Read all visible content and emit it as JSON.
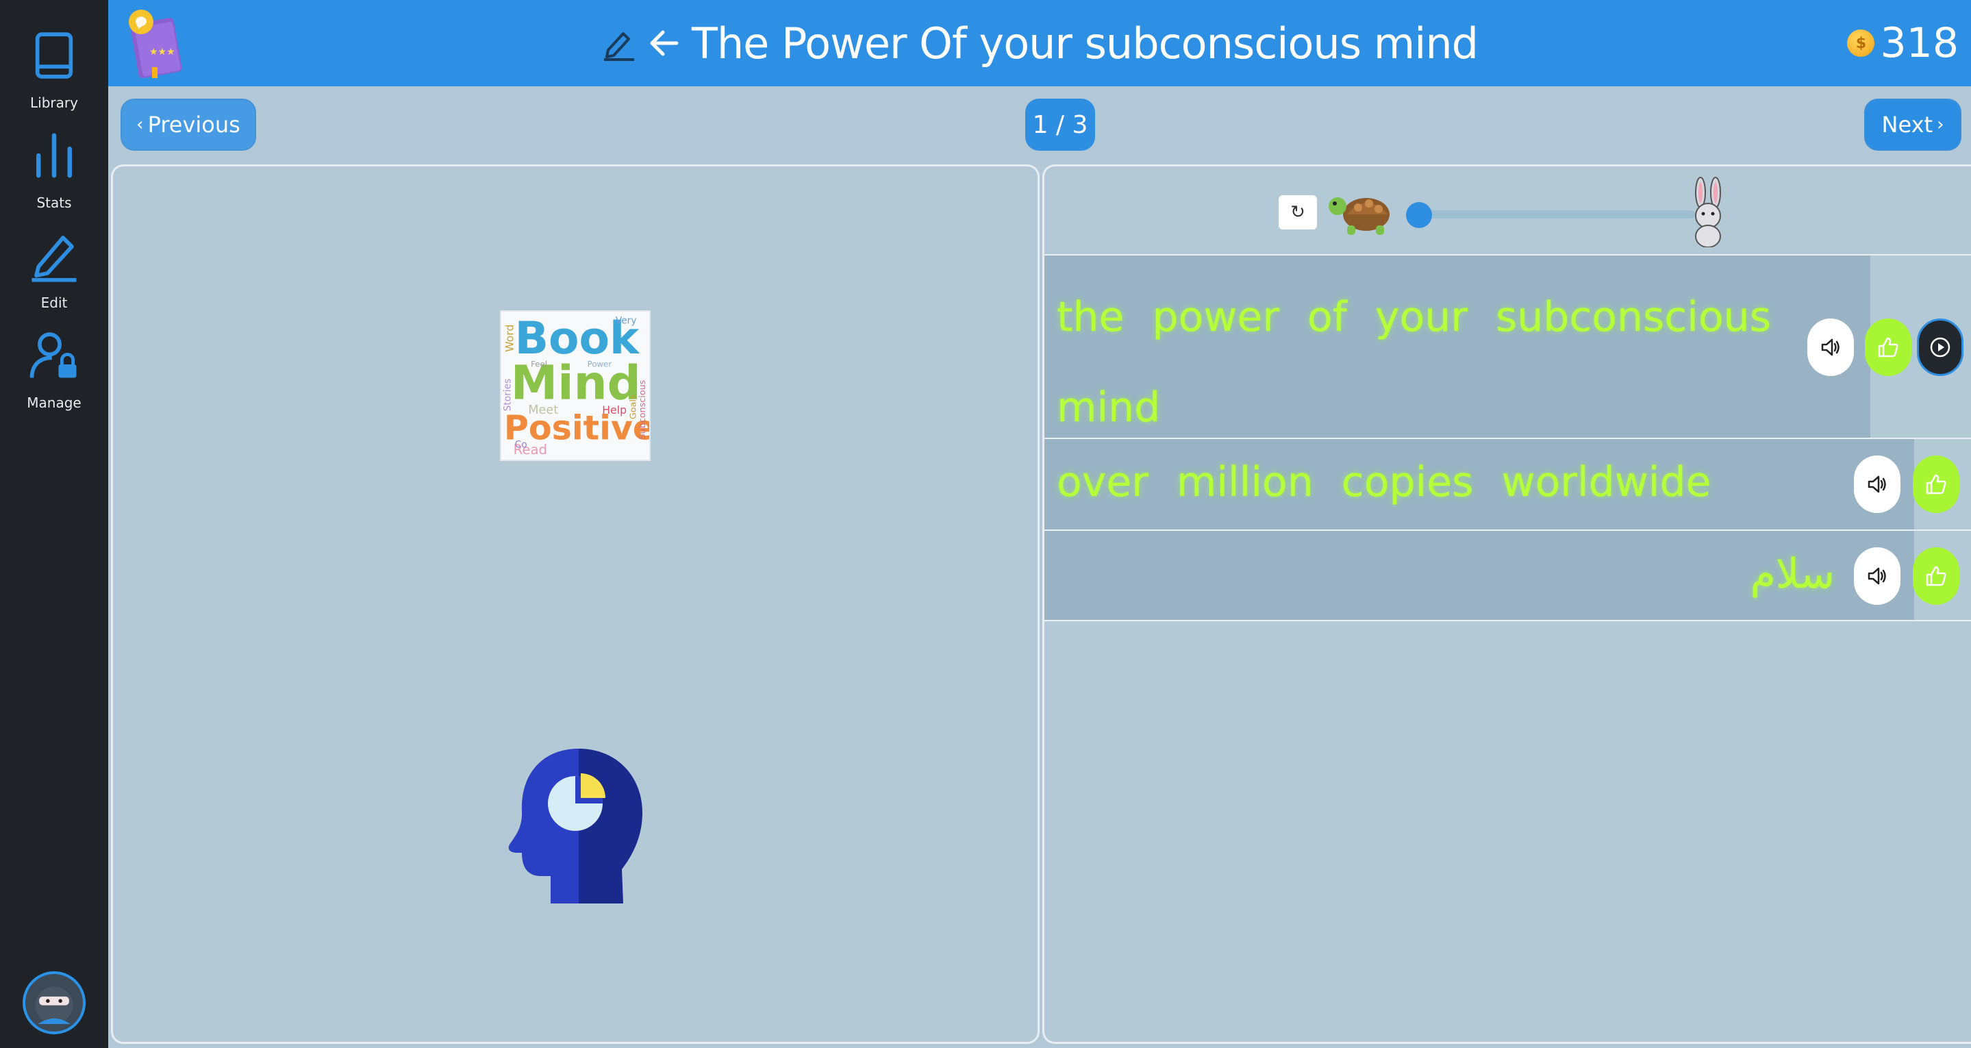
{
  "sidebar": {
    "items": [
      {
        "label": "Library",
        "icon": "book-icon"
      },
      {
        "label": "Stats",
        "icon": "bar-chart-icon"
      },
      {
        "label": "Edit",
        "icon": "pencil-icon"
      },
      {
        "label": "Manage",
        "icon": "user-lock-icon"
      }
    ],
    "avatar_icon": "ninja-avatar-icon"
  },
  "header": {
    "title": "The Power Of your subconscious mind",
    "coins": "318",
    "logo_icon": "storybook-logo-icon"
  },
  "toolbar": {
    "previous_label": "Previous",
    "next_label": "Next",
    "page_counter": "1 / 3"
  },
  "speed": {
    "slow_icon": "turtle-icon",
    "fast_icon": "rabbit-icon",
    "reset_icon": "reset-icon",
    "level": 0.0
  },
  "sentences": [
    {
      "text": "the power of your subconscious mind",
      "direction": "ltr"
    },
    {
      "text": "over million copies worldwide",
      "direction": "ltr"
    },
    {
      "text": "سلام",
      "direction": "rtl"
    }
  ],
  "wordcloud_words": [
    "Book",
    "Mind",
    "Positive",
    "Word",
    "Stories",
    "Very",
    "Goals",
    "Subconscious",
    "Help",
    "Read",
    "Feel",
    "Meet",
    "Co",
    "Power"
  ],
  "colors": {
    "header_blue": "#2e90e4",
    "sidebar": "#1f2327",
    "sentence_text": "#b6ff3a",
    "like_green": "#a8f534"
  }
}
